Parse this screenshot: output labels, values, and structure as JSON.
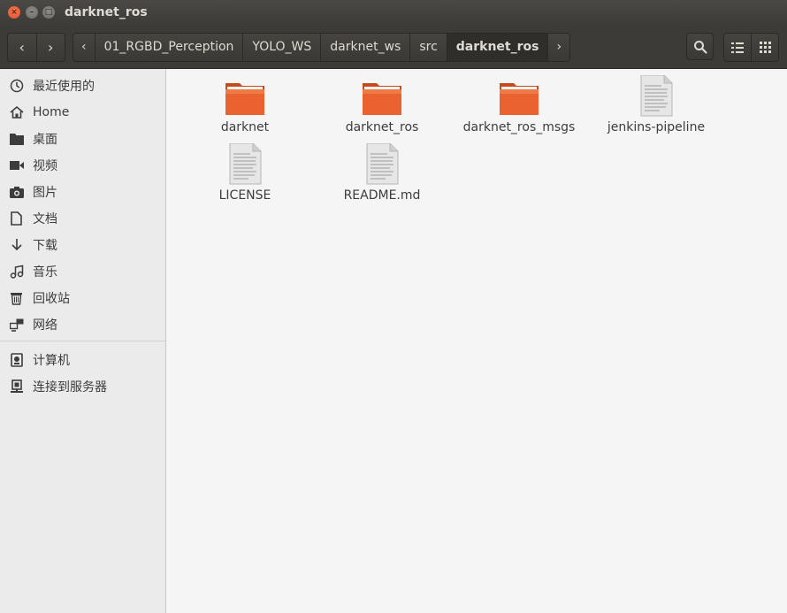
{
  "window": {
    "title": "darknet_ros",
    "buttons": {
      "close": "×",
      "minimize": "–",
      "maximize": "□"
    }
  },
  "toolbar": {
    "back": "‹",
    "forward": "›",
    "path_left_arrow": "‹",
    "path_right_arrow": "›",
    "breadcrumbs": [
      "01_RGBD_Perception",
      "YOLO_WS",
      "darknet_ws",
      "src",
      "darknet_ros"
    ],
    "search_icon": "search-icon",
    "list_view_icon": "list-view-icon",
    "grid_view_icon": "grid-view-icon"
  },
  "sidebar": {
    "items": [
      {
        "label": "最近使用的",
        "icon": "clock-icon"
      },
      {
        "label": "Home",
        "icon": "home-icon"
      },
      {
        "label": "桌面",
        "icon": "folder-icon"
      },
      {
        "label": "视频",
        "icon": "video-icon"
      },
      {
        "label": "图片",
        "icon": "camera-icon"
      },
      {
        "label": "文档",
        "icon": "document-icon"
      },
      {
        "label": "下载",
        "icon": "download-icon"
      },
      {
        "label": "音乐",
        "icon": "music-icon"
      },
      {
        "label": "回收站",
        "icon": "trash-icon"
      },
      {
        "label": "网络",
        "icon": "network-icon"
      },
      {
        "label": "计算机",
        "icon": "computer-icon"
      },
      {
        "label": "连接到服务器",
        "icon": "server-icon"
      }
    ]
  },
  "files": [
    {
      "name": "darknet",
      "type": "folder"
    },
    {
      "name": "darknet_ros",
      "type": "folder"
    },
    {
      "name": "darknet_ros_msgs",
      "type": "folder"
    },
    {
      "name": "jenkins-pipeline",
      "type": "text"
    },
    {
      "name": "LICENSE",
      "type": "text"
    },
    {
      "name": "README.md",
      "type": "text"
    }
  ],
  "colors": {
    "folder_orange": "#e9622f",
    "titlebar": "#3c3b37",
    "close_button": "#e9562f"
  }
}
